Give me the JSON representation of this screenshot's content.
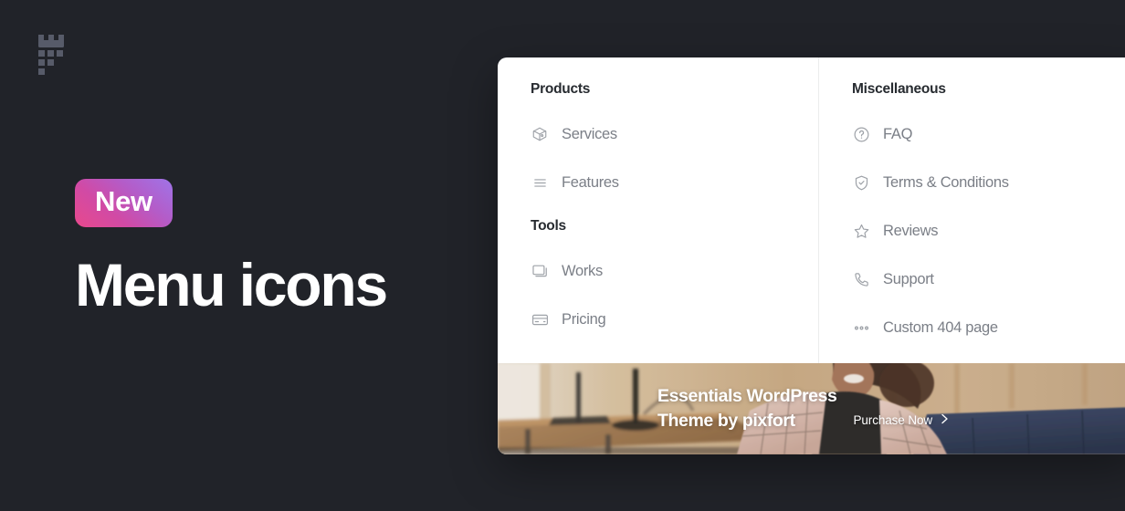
{
  "brand": {
    "logo_icon": "pixfort-tower-logo",
    "logo_color": "#575b69"
  },
  "hero": {
    "badge_label": "New",
    "title": "Menu icons",
    "badge_gradient_from": "#e8498c",
    "badge_gradient_to": "#9f74e8",
    "title_color": "#ffffff",
    "background_color": "#212329"
  },
  "dropdown": {
    "columns": [
      {
        "sections": [
          {
            "heading": "Products",
            "items": [
              {
                "label": "Services",
                "icon": "package-box-icon"
              },
              {
                "label": "Features",
                "icon": "list-lines-icon"
              }
            ]
          },
          {
            "heading": "Tools",
            "items": [
              {
                "label": "Works",
                "icon": "stacked-windows-icon"
              },
              {
                "label": "Pricing",
                "icon": "credit-card-icon"
              }
            ]
          }
        ]
      },
      {
        "sections": [
          {
            "heading": "Miscellaneous",
            "items": [
              {
                "label": "FAQ",
                "icon": "question-circle-icon"
              },
              {
                "label": "Terms & Conditions",
                "icon": "shield-check-icon"
              },
              {
                "label": "Reviews",
                "icon": "star-icon"
              },
              {
                "label": "Support",
                "icon": "phone-icon"
              },
              {
                "label": "Custom 404 page",
                "icon": "ellipsis-icon"
              }
            ]
          }
        ]
      }
    ],
    "promo": {
      "title": "Essentials WordPress\nTheme by pixfort",
      "cta_label": "Purchase Now",
      "cta_icon": "chevron-right-icon",
      "photo_alt": "woman-smiling-at-desk-photo"
    }
  }
}
